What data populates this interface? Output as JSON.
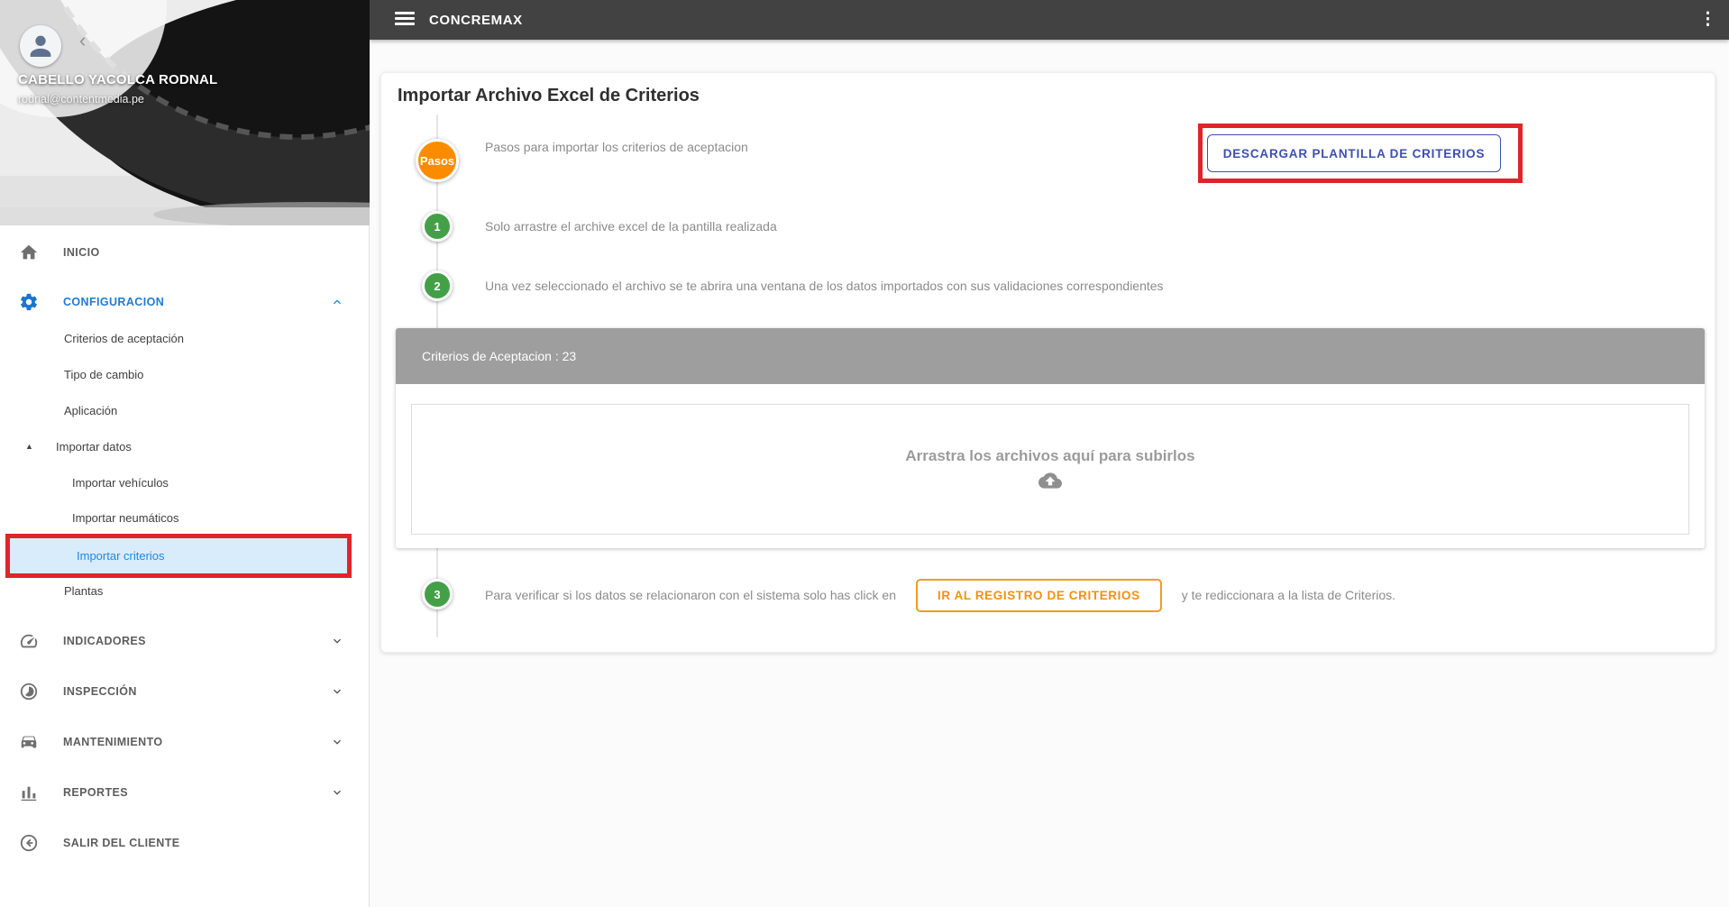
{
  "topbar": {
    "title": "CONCREMAX",
    "kebab_icon": "⋮"
  },
  "user": {
    "name": "CABELLO YACOLCA RODNAL",
    "email": "rodnal@contentmedia.pe",
    "collapse_chevron": "‹"
  },
  "sidebar": {
    "items": [
      {
        "label": "INICIO"
      },
      {
        "label": "CONFIGURACION"
      },
      {
        "label": "Criterios de aceptación"
      },
      {
        "label": "Tipo de cambio"
      },
      {
        "label": "Aplicación"
      },
      {
        "label": "Importar datos",
        "expander": "▲"
      },
      {
        "label": "Importar vehículos"
      },
      {
        "label": "Importar neumáticos"
      },
      {
        "label": "Importar criterios"
      },
      {
        "label": "Plantas"
      },
      {
        "label": "INDICADORES"
      },
      {
        "label": "INSPECCIÓN"
      },
      {
        "label": "MANTENIMIENTO"
      },
      {
        "label": "REPORTES"
      },
      {
        "label": "SALIR DEL CLIENTE"
      }
    ]
  },
  "main": {
    "title": "Importar Archivo Excel de Criterios",
    "download_button": "DESCARGAR PLANTILLA DE CRITERIOS",
    "steps": {
      "intro_badge": "Pasos",
      "intro_text": "Pasos para importar los criterios de aceptacion",
      "step1_num": "1",
      "step1_text": "Solo arrastre el archive excel de la pantilla realizada",
      "step2_num": "2",
      "step2_text": "Una vez seleccionado el archivo se te abrira una ventana de los datos importados con sus validaciones correspondientes",
      "step3_num": "3",
      "step3_text_before": "Para verificar si los datos se relacionaron con el sistema solo has click en",
      "step3_button": "IR AL REGISTRO DE CRITERIOS",
      "step3_text_after": "y te rediccionara a la lista de Criterios."
    },
    "panel": {
      "header": "Criterios de Aceptacion : 23",
      "dropzone_text": "Arrastra los archivos aquí para subirlos"
    }
  },
  "colors": {
    "topbar_bg": "#424242",
    "accent_blue": "#1e88e5",
    "indigo_button": "#3c4fb1",
    "orange_badge": "#fb8c00",
    "orange_button": "#f49b1d",
    "green_step": "#43a047",
    "panel_header_bg": "#9e9e9e",
    "annotation_red": "#e1242a",
    "active_item_bg": "#d9ecfb"
  }
}
